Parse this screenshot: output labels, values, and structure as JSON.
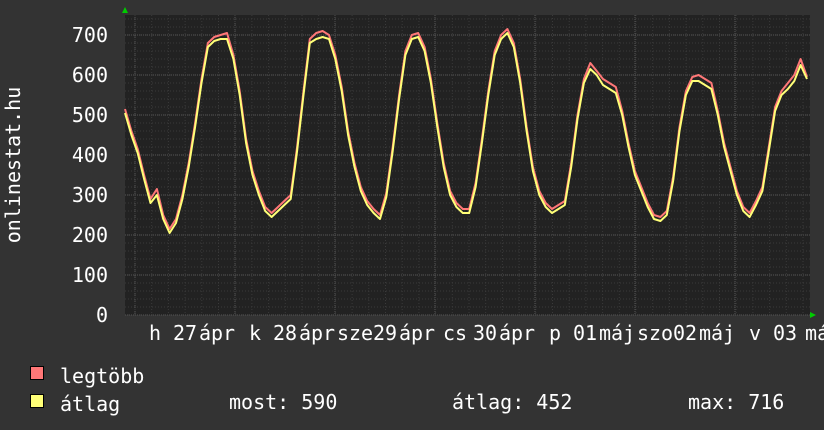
{
  "chart_data": {
    "type": "line",
    "ylabel": "onlinestat.hu",
    "ylim": [
      0,
      750
    ],
    "y_ticks": [
      "0",
      "100",
      "200",
      "300",
      "400",
      "500",
      "600",
      "700"
    ],
    "x_tick_labels": [
      "h",
      "27",
      "ápr",
      "k",
      "28",
      "ápr",
      "sze",
      "29",
      "ápr",
      "cs",
      "30",
      "ápr",
      "p",
      "01",
      "máj",
      "szo",
      "02",
      "máj",
      "v",
      "03",
      "má"
    ],
    "grid": true,
    "series": [
      {
        "name": "legtöbb",
        "color": "#ff7777",
        "values": [
          515,
          460,
          415,
          350,
          290,
          315,
          250,
          215,
          240,
          300,
          380,
          480,
          590,
          680,
          695,
          700,
          705,
          650,
          560,
          440,
          360,
          310,
          270,
          255,
          270,
          285,
          300,
          420,
          560,
          690,
          705,
          710,
          700,
          650,
          570,
          460,
          380,
          320,
          285,
          265,
          250,
          305,
          420,
          550,
          660,
          700,
          705,
          670,
          590,
          480,
          380,
          310,
          280,
          265,
          265,
          330,
          440,
          560,
          660,
          700,
          715,
          680,
          590,
          470,
          370,
          310,
          280,
          265,
          275,
          285,
          380,
          500,
          590,
          630,
          610,
          590,
          580,
          570,
          510,
          430,
          360,
          320,
          280,
          250,
          245,
          260,
          345,
          470,
          560,
          595,
          600,
          590,
          580,
          510,
          430,
          370,
          310,
          270,
          255,
          285,
          320,
          420,
          520,
          560,
          580,
          600,
          640,
          595
        ]
      },
      {
        "name": "átlag",
        "color": "#ffff77",
        "values": [
          505,
          450,
          405,
          340,
          280,
          300,
          240,
          205,
          230,
          290,
          370,
          470,
          580,
          670,
          685,
          690,
          690,
          640,
          550,
          430,
          350,
          300,
          260,
          245,
          260,
          275,
          290,
          410,
          550,
          680,
          690,
          695,
          690,
          640,
          560,
          450,
          370,
          310,
          275,
          255,
          240,
          295,
          410,
          540,
          650,
          690,
          695,
          660,
          580,
          470,
          370,
          300,
          270,
          255,
          255,
          320,
          430,
          550,
          650,
          690,
          705,
          670,
          580,
          460,
          360,
          300,
          270,
          255,
          265,
          275,
          370,
          490,
          580,
          615,
          600,
          575,
          565,
          555,
          500,
          420,
          350,
          310,
          270,
          240,
          235,
          250,
          335,
          460,
          550,
          585,
          585,
          575,
          565,
          500,
          420,
          360,
          300,
          260,
          245,
          275,
          310,
          410,
          510,
          550,
          565,
          585,
          625,
          590
        ]
      }
    ]
  },
  "legend": {
    "max_label": "legtöbb",
    "avg_label": "átlag",
    "now": "most: 590",
    "avg": "átlag: 452",
    "max": "max: 716"
  },
  "colors": {
    "background": "#333333",
    "plot_bg": "#222222",
    "grid": "#555555",
    "minor_grid": "#3a3a3a",
    "axis_arrow": "#00cc00"
  }
}
